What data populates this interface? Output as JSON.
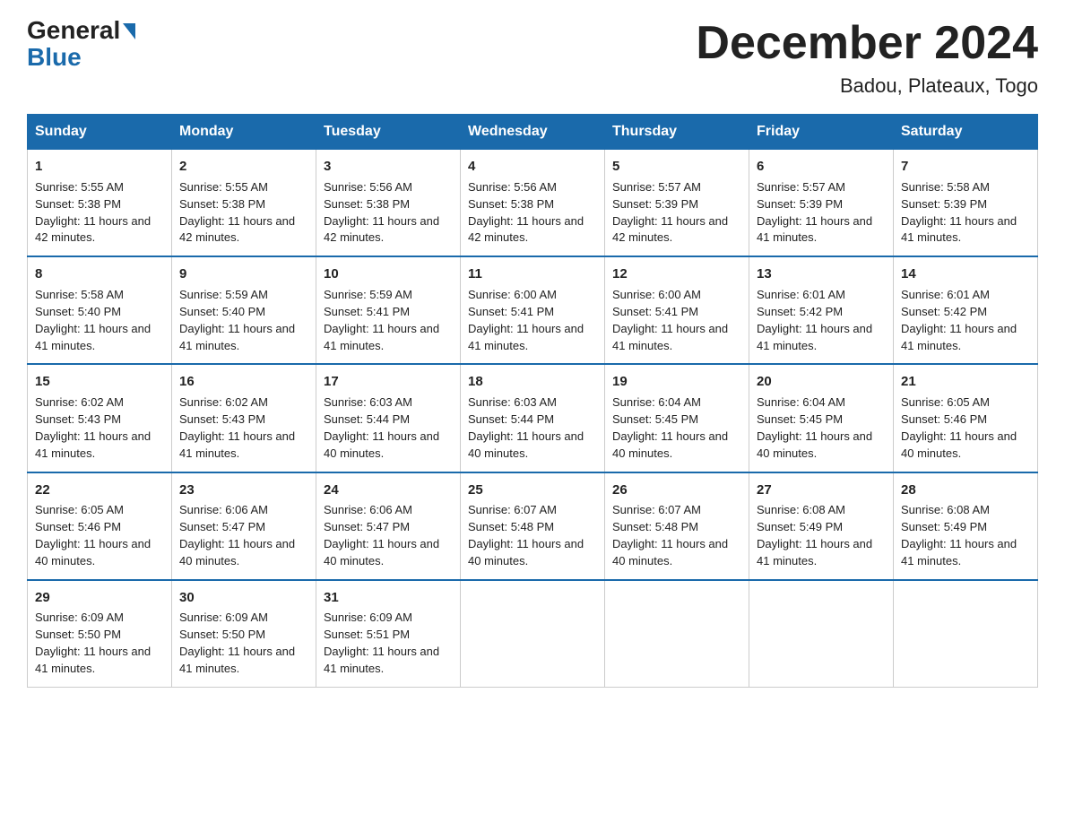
{
  "logo": {
    "general": "General",
    "blue": "Blue"
  },
  "title": "December 2024",
  "subtitle": "Badou, Plateaux, Togo",
  "headers": [
    "Sunday",
    "Monday",
    "Tuesday",
    "Wednesday",
    "Thursday",
    "Friday",
    "Saturday"
  ],
  "weeks": [
    [
      {
        "day": "1",
        "sunrise": "5:55 AM",
        "sunset": "5:38 PM",
        "daylight": "11 hours and 42 minutes."
      },
      {
        "day": "2",
        "sunrise": "5:55 AM",
        "sunset": "5:38 PM",
        "daylight": "11 hours and 42 minutes."
      },
      {
        "day": "3",
        "sunrise": "5:56 AM",
        "sunset": "5:38 PM",
        "daylight": "11 hours and 42 minutes."
      },
      {
        "day": "4",
        "sunrise": "5:56 AM",
        "sunset": "5:38 PM",
        "daylight": "11 hours and 42 minutes."
      },
      {
        "day": "5",
        "sunrise": "5:57 AM",
        "sunset": "5:39 PM",
        "daylight": "11 hours and 42 minutes."
      },
      {
        "day": "6",
        "sunrise": "5:57 AM",
        "sunset": "5:39 PM",
        "daylight": "11 hours and 41 minutes."
      },
      {
        "day": "7",
        "sunrise": "5:58 AM",
        "sunset": "5:39 PM",
        "daylight": "11 hours and 41 minutes."
      }
    ],
    [
      {
        "day": "8",
        "sunrise": "5:58 AM",
        "sunset": "5:40 PM",
        "daylight": "11 hours and 41 minutes."
      },
      {
        "day": "9",
        "sunrise": "5:59 AM",
        "sunset": "5:40 PM",
        "daylight": "11 hours and 41 minutes."
      },
      {
        "day": "10",
        "sunrise": "5:59 AM",
        "sunset": "5:41 PM",
        "daylight": "11 hours and 41 minutes."
      },
      {
        "day": "11",
        "sunrise": "6:00 AM",
        "sunset": "5:41 PM",
        "daylight": "11 hours and 41 minutes."
      },
      {
        "day": "12",
        "sunrise": "6:00 AM",
        "sunset": "5:41 PM",
        "daylight": "11 hours and 41 minutes."
      },
      {
        "day": "13",
        "sunrise": "6:01 AM",
        "sunset": "5:42 PM",
        "daylight": "11 hours and 41 minutes."
      },
      {
        "day": "14",
        "sunrise": "6:01 AM",
        "sunset": "5:42 PM",
        "daylight": "11 hours and 41 minutes."
      }
    ],
    [
      {
        "day": "15",
        "sunrise": "6:02 AM",
        "sunset": "5:43 PM",
        "daylight": "11 hours and 41 minutes."
      },
      {
        "day": "16",
        "sunrise": "6:02 AM",
        "sunset": "5:43 PM",
        "daylight": "11 hours and 41 minutes."
      },
      {
        "day": "17",
        "sunrise": "6:03 AM",
        "sunset": "5:44 PM",
        "daylight": "11 hours and 40 minutes."
      },
      {
        "day": "18",
        "sunrise": "6:03 AM",
        "sunset": "5:44 PM",
        "daylight": "11 hours and 40 minutes."
      },
      {
        "day": "19",
        "sunrise": "6:04 AM",
        "sunset": "5:45 PM",
        "daylight": "11 hours and 40 minutes."
      },
      {
        "day": "20",
        "sunrise": "6:04 AM",
        "sunset": "5:45 PM",
        "daylight": "11 hours and 40 minutes."
      },
      {
        "day": "21",
        "sunrise": "6:05 AM",
        "sunset": "5:46 PM",
        "daylight": "11 hours and 40 minutes."
      }
    ],
    [
      {
        "day": "22",
        "sunrise": "6:05 AM",
        "sunset": "5:46 PM",
        "daylight": "11 hours and 40 minutes."
      },
      {
        "day": "23",
        "sunrise": "6:06 AM",
        "sunset": "5:47 PM",
        "daylight": "11 hours and 40 minutes."
      },
      {
        "day": "24",
        "sunrise": "6:06 AM",
        "sunset": "5:47 PM",
        "daylight": "11 hours and 40 minutes."
      },
      {
        "day": "25",
        "sunrise": "6:07 AM",
        "sunset": "5:48 PM",
        "daylight": "11 hours and 40 minutes."
      },
      {
        "day": "26",
        "sunrise": "6:07 AM",
        "sunset": "5:48 PM",
        "daylight": "11 hours and 40 minutes."
      },
      {
        "day": "27",
        "sunrise": "6:08 AM",
        "sunset": "5:49 PM",
        "daylight": "11 hours and 41 minutes."
      },
      {
        "day": "28",
        "sunrise": "6:08 AM",
        "sunset": "5:49 PM",
        "daylight": "11 hours and 41 minutes."
      }
    ],
    [
      {
        "day": "29",
        "sunrise": "6:09 AM",
        "sunset": "5:50 PM",
        "daylight": "11 hours and 41 minutes."
      },
      {
        "day": "30",
        "sunrise": "6:09 AM",
        "sunset": "5:50 PM",
        "daylight": "11 hours and 41 minutes."
      },
      {
        "day": "31",
        "sunrise": "6:09 AM",
        "sunset": "5:51 PM",
        "daylight": "11 hours and 41 minutes."
      },
      null,
      null,
      null,
      null
    ]
  ],
  "labels": {
    "sunrise": "Sunrise:",
    "sunset": "Sunset:",
    "daylight": "Daylight:"
  },
  "colors": {
    "header_bg": "#1a6aab",
    "header_text": "#ffffff",
    "border": "#cccccc",
    "accent": "#1a6aab"
  }
}
